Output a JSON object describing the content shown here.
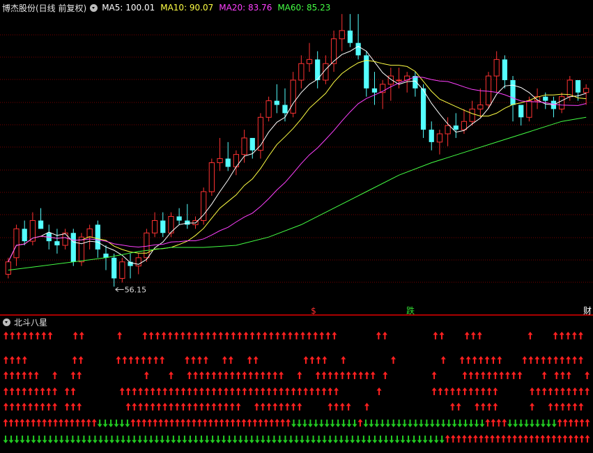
{
  "header": {
    "title": "博杰股份(日线 前复权)",
    "ma": [
      {
        "label": "MA5: 100.01",
        "color": "#ffffff"
      },
      {
        "label": "MA10: 90.07",
        "color": "#ffff44"
      },
      {
        "label": "MA20: 83.76",
        "color": "#ff40ff"
      },
      {
        "label": "MA60: 85.23",
        "color": "#44ff44"
      }
    ]
  },
  "annotations": {
    "low_price": "56.15",
    "markers": [
      {
        "text": "$",
        "color": "#ff3030"
      },
      {
        "text": "跌",
        "color": "#33dd33"
      },
      {
        "text": "财",
        "color": "#ffffff"
      }
    ]
  },
  "indicator": {
    "title": "北斗八星"
  },
  "colors": {
    "up": "#ff3232",
    "down": "#54ffff",
    "grid": "#7a0000",
    "arrow_up": "#ff2020",
    "arrow_down": "#22cc22"
  },
  "chart_data": {
    "type": "candlestick",
    "ylim": [
      52,
      120
    ],
    "min_label": "56.15",
    "candles": [
      [
        59,
        63,
        58,
        62
      ],
      [
        63,
        71,
        61,
        70
      ],
      [
        70,
        72,
        66,
        67
      ],
      [
        67,
        74,
        66,
        72
      ],
      [
        72,
        75,
        70,
        70
      ],
      [
        69,
        71,
        65,
        67
      ],
      [
        67,
        70,
        64,
        66
      ],
      [
        66,
        70,
        65,
        69
      ],
      [
        69,
        70,
        61,
        62
      ],
      [
        62,
        69,
        61,
        68
      ],
      [
        68,
        71,
        65,
        70
      ],
      [
        71,
        72,
        63,
        65
      ],
      [
        64,
        66,
        60,
        63
      ],
      [
        63,
        64,
        56,
        58
      ],
      [
        58,
        63,
        57,
        62
      ],
      [
        62,
        64,
        58,
        61
      ],
      [
        61,
        64,
        59,
        63
      ],
      [
        63,
        70,
        62,
        69
      ],
      [
        69,
        74,
        68,
        72
      ],
      [
        72,
        74,
        68,
        69
      ],
      [
        69,
        74,
        68,
        73
      ],
      [
        73,
        75,
        71,
        72
      ],
      [
        72,
        76,
        70,
        71
      ],
      [
        71,
        73,
        70,
        72
      ],
      [
        72,
        80,
        71,
        79
      ],
      [
        79,
        87,
        78,
        86
      ],
      [
        86,
        92,
        84,
        87
      ],
      [
        87,
        91,
        84,
        85
      ],
      [
        85,
        89,
        83,
        88
      ],
      [
        88,
        94,
        86,
        92
      ],
      [
        92,
        91,
        87,
        89
      ],
      [
        89,
        98,
        87,
        97
      ],
      [
        97,
        102,
        96,
        101
      ],
      [
        101,
        105,
        98,
        100
      ],
      [
        100,
        104,
        96,
        98
      ],
      [
        98,
        108,
        97,
        106
      ],
      [
        106,
        112,
        104,
        110
      ],
      [
        110,
        115,
        108,
        111
      ],
      [
        111,
        113,
        104,
        106
      ],
      [
        106,
        112,
        105,
        110
      ],
      [
        110,
        118,
        108,
        116
      ],
      [
        116,
        122,
        113,
        118
      ],
      [
        118,
        122,
        114,
        115
      ],
      [
        115,
        122,
        111,
        112
      ],
      [
        112,
        113,
        102,
        104
      ],
      [
        104,
        108,
        100,
        103
      ],
      [
        103,
        106,
        99,
        105
      ],
      [
        105,
        109,
        101,
        107
      ],
      [
        106,
        109,
        104,
        106
      ],
      [
        106,
        108,
        103,
        107
      ],
      [
        107,
        108,
        102,
        104
      ],
      [
        104,
        105,
        92,
        94
      ],
      [
        94,
        96,
        89,
        91
      ],
      [
        91,
        94,
        88,
        93
      ],
      [
        93,
        97,
        90,
        95
      ],
      [
        95,
        98,
        92,
        94
      ],
      [
        94,
        99,
        93,
        96
      ],
      [
        96,
        101,
        95,
        99
      ],
      [
        99,
        104,
        97,
        100
      ],
      [
        100,
        108,
        99,
        107
      ],
      [
        107,
        113,
        103,
        111
      ],
      [
        111,
        112,
        104,
        106
      ],
      [
        106,
        107,
        96,
        100
      ],
      [
        100,
        99,
        95,
        97
      ],
      [
        97,
        102,
        96,
        101
      ],
      [
        101,
        104,
        99,
        102
      ],
      [
        102,
        103,
        99,
        101
      ],
      [
        101,
        102,
        97,
        99
      ],
      [
        99,
        103,
        98,
        102
      ],
      [
        102,
        107,
        101,
        106
      ],
      [
        106,
        105,
        101,
        103
      ],
      [
        103,
        105,
        100,
        104
      ]
    ],
    "ma_series": [
      {
        "name": "MA5",
        "color": "#ffffff"
      },
      {
        "name": "MA10",
        "color": "#ffff44"
      },
      {
        "name": "MA20",
        "color": "#ff40ff"
      },
      {
        "name": "MA60",
        "color": "#44ff44"
      }
    ],
    "ma60": [
      [
        0,
        60
      ],
      [
        4,
        61
      ],
      [
        8,
        62
      ],
      [
        12,
        63
      ],
      [
        16,
        64.5
      ],
      [
        20,
        65.5
      ],
      [
        24,
        65.5
      ],
      [
        28,
        66
      ],
      [
        32,
        68
      ],
      [
        36,
        71
      ],
      [
        40,
        75
      ],
      [
        44,
        79
      ],
      [
        48,
        83
      ],
      [
        52,
        86
      ],
      [
        56,
        88.5
      ],
      [
        60,
        91
      ],
      [
        64,
        93.5
      ],
      [
        68,
        96
      ],
      [
        71,
        97
      ]
    ],
    "indicator_rows": {
      "row1": "UUUUUUUU...UU.....U...UUUUUUUUUUUUUUUUUUUUUUUUUUUUUUU......UU.......UU...UUU.......U...UUUUU.",
      "row2": "UUUU.......UU.....UUUUUUUU...UUUU..UU..UU.......UUUU..U.......U.......U..UUUUUUU...UUUUUUUUUU.",
      "row3": "UUUUUU..U..UU..........U...U..UUUUUUUUUUUUUUUU..U..UUUUUUUUUU.U.......U....UUUUUUUUUU...U.UUU..U",
      "row4": "UUUUUUUUU.UU.......UUUUUUUUUUUUUUUUUUUUUUUUUUUUUUUUUUUU......U........UUUUUUUUUUU.....UUUUUUUUUU",
      "row5": "UUUUUUUUU.UUU.......UUUUUUUUUUUUUUUUUUU..UUUUUUUU....UUUU..U.............UU..UUUU.....U..UUUUUU.",
      "row6": "UUUUUUUUUUUUUUUUUDDDDDDUUUUUUUUUUUUUUUUUUUUUUUUUUUUUDDDDDDDDDDDDUDDDDDDDDDDDDDDDDDDDDDDUUUUDDDDDDDDDUUUUUU",
      "row7": "DDDDDDDDDDDDDDDDDDDDDDDDDDDDDDDDDDDDDDDDDDDDDDDDDDDDDDDDDDDDDDDDDDDDDDDDDDDDDDDUUUUUUUUUUUUUUUUUUUUUUUUUU"
    }
  }
}
